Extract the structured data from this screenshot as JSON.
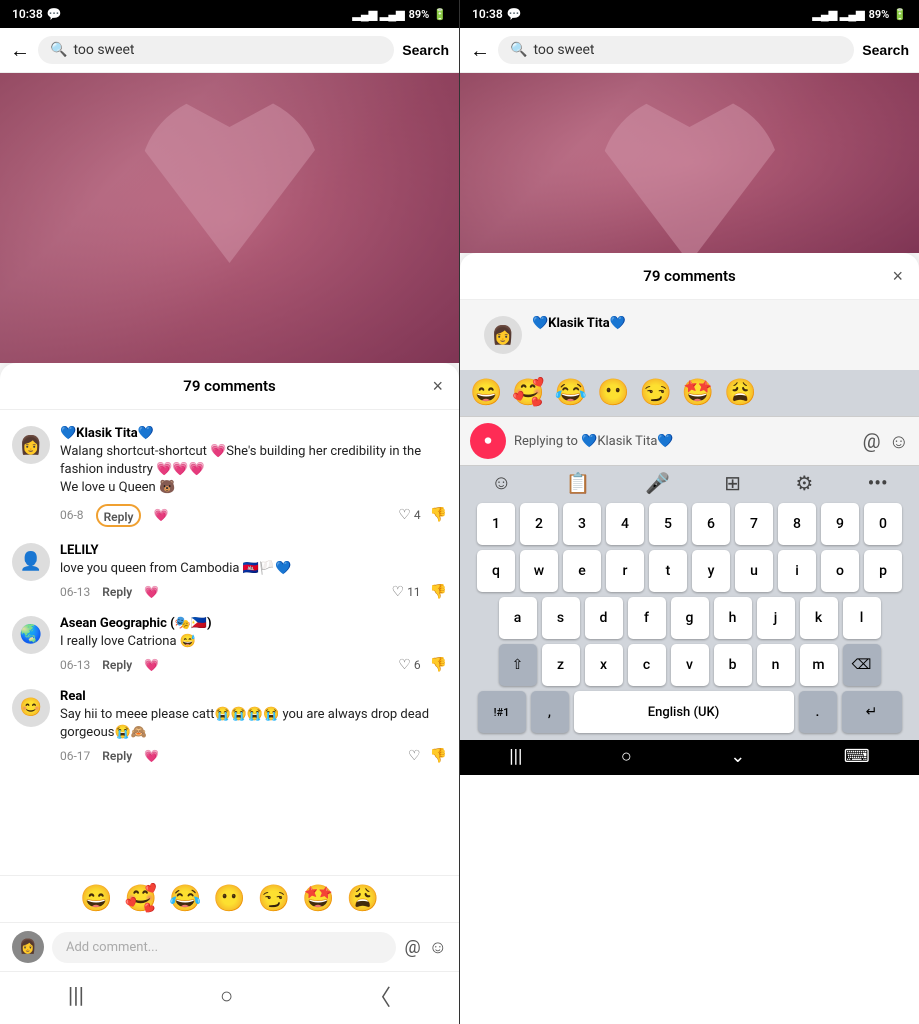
{
  "left_panel": {
    "status": {
      "time": "10:38",
      "messenger_icon": "💬",
      "battery": "89%"
    },
    "search": {
      "back_label": "←",
      "query": "too sweet",
      "button_label": "Search"
    },
    "comments": {
      "title": "79 comments",
      "close_label": "×",
      "items": [
        {
          "username": "💙Klasik Tita💙",
          "text": "Walang shortcut-shortcut 💗She's building her credibility in the fashion industry 💗💗💗\nWe love u Queen 🐻",
          "date": "06-8",
          "reply": "Reply",
          "emoji": "💗",
          "likes": "4"
        },
        {
          "username": "LELILY",
          "text": "love you queen from Cambodia 🇰🇭🏳️💙",
          "date": "06-13",
          "reply": "Reply",
          "emoji": "💗",
          "likes": "11"
        },
        {
          "username": "Asean Geographic (🎭🇵🇭)",
          "text": "I really love Catriona 😅",
          "date": "06-13",
          "reply": "Reply",
          "emoji": "💗",
          "likes": "6"
        },
        {
          "username": "Real",
          "text": "Say hii to meee please catt😭😭😭😭 you are always drop dead gorgeous😭🙈",
          "date": "06-17",
          "reply": "Reply",
          "emoji": "💗",
          "likes": ""
        }
      ]
    },
    "emoji_row": [
      "😄",
      "🥰",
      "😂",
      "😶",
      "😏",
      "🤩",
      "😩"
    ],
    "add_comment_placeholder": "Add comment...",
    "nav": [
      "|||",
      "○",
      "<"
    ]
  },
  "right_panel": {
    "status": {
      "time": "10:38",
      "messenger_icon": "💬",
      "battery": "89%"
    },
    "search": {
      "back_label": "←",
      "query": "too sweet",
      "button_label": "Search"
    },
    "comments": {
      "title": "79 comments",
      "close_label": "×",
      "username_preview": "💙Klasik Tita💙"
    },
    "emoji_top_row": [
      "😄",
      "🥰",
      "😂",
      "😶",
      "😏",
      "🤩",
      "😩"
    ],
    "replying_to": "Replying to 💙Klasik Tita💙",
    "keyboard": {
      "row_numbers": [
        "1",
        "2",
        "3",
        "4",
        "5",
        "6",
        "7",
        "8",
        "9",
        "0"
      ],
      "row1": [
        "q",
        "w",
        "e",
        "r",
        "t",
        "y",
        "u",
        "i",
        "o",
        "p"
      ],
      "row2": [
        "a",
        "s",
        "d",
        "f",
        "g",
        "h",
        "j",
        "k",
        "l"
      ],
      "row3_special": "⇧",
      "row3": [
        "z",
        "x",
        "c",
        "v",
        "b",
        "n",
        "m"
      ],
      "row3_del": "⌫",
      "row4_nums": "!#1",
      "row4_comma": ",",
      "row4_space": "English (UK)",
      "row4_period": ".",
      "row4_enter": "↵"
    },
    "nav": [
      "|||",
      "○",
      "⌄",
      "⌨"
    ]
  }
}
